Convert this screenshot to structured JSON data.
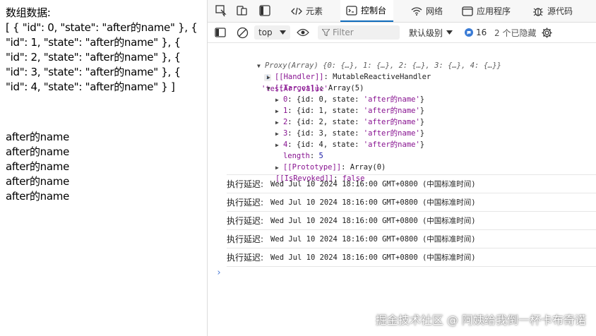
{
  "page": {
    "heading": "数组数据:",
    "array_lines": [
      "[ { \"id\": 0, \"state\": \"after的name\" }, {",
      "\"id\": 1, \"state\": \"after的name\" }, {",
      "\"id\": 2, \"state\": \"after的name\" }, {",
      "\"id\": 3, \"state\": \"after的name\" }, {",
      "\"id\": 4, \"state\": \"after的name\" } ]"
    ],
    "items": [
      "after的name",
      "after的name",
      "after的name",
      "after的name",
      "after的name"
    ]
  },
  "devtools": {
    "tabs": [
      {
        "label": "元素",
        "icon": "code-icon"
      },
      {
        "label": "控制台",
        "icon": "console-icon",
        "active": true
      },
      {
        "label": "网络",
        "icon": "wifi-icon"
      },
      {
        "label": "应用程序",
        "icon": "app-icon"
      },
      {
        "label": "源代码",
        "icon": "bug-icon"
      }
    ],
    "toolbar": {
      "context": "top",
      "filter_placeholder": "Filter",
      "level": "默认级别",
      "issues_count": "16",
      "hidden": "2 个已隐藏"
    },
    "console": {
      "proxy_summary": "Proxy(Array) {0: {…}, 1: {…}, 2: {…}, 3: {…}, 4: {…}}",
      "proxy_label": "'testArr.value'",
      "handler_key": "[[Handler]]",
      "handler_val": "MutableReactiveHandler",
      "target_key": "[[Target]]",
      "target_val": "Array(5)",
      "entries": [
        {
          "index": "0",
          "text": "{id: 0, state: ",
          "state": "'after的name'"
        },
        {
          "index": "1",
          "text": "{id: 1, state: ",
          "state": "'after的name'"
        },
        {
          "index": "2",
          "text": "{id: 2, state: ",
          "state": "'after的name'"
        },
        {
          "index": "3",
          "text": "{id: 3, state: ",
          "state": "'after的name'"
        },
        {
          "index": "4",
          "text": "{id: 4, state: ",
          "state": "'after的name'"
        }
      ],
      "length_key": "length",
      "length_val": "5",
      "prototype_key": "[[Prototype]]",
      "prototype_val": "Array(0)",
      "revoked_key": "[[IsRevoked]]",
      "revoked_val": "false",
      "logs": [
        {
          "label": "执行延迟:",
          "value": "Wed Jul 10 2024 18:16:00 GMT+0800 (中国标准时间)"
        },
        {
          "label": "执行延迟:",
          "value": "Wed Jul 10 2024 18:16:00 GMT+0800 (中国标准时间)"
        },
        {
          "label": "执行延迟:",
          "value": "Wed Jul 10 2024 18:16:00 GMT+0800 (中国标准时间)"
        },
        {
          "label": "执行延迟:",
          "value": "Wed Jul 10 2024 18:16:00 GMT+0800 (中国标准时间)"
        },
        {
          "label": "执行延迟:",
          "value": "Wed Jul 10 2024 18:16:00 GMT+0800 (中国标准时间)"
        }
      ],
      "prompt": "›"
    },
    "watermark": "掘金技术社区 @ 阿姨给我倒一杯卡布奇诺"
  },
  "colors": {
    "accent": "#0f6cbd",
    "string": "#881391",
    "number": "#1a1aa6",
    "issues": "#3a7bd5"
  }
}
